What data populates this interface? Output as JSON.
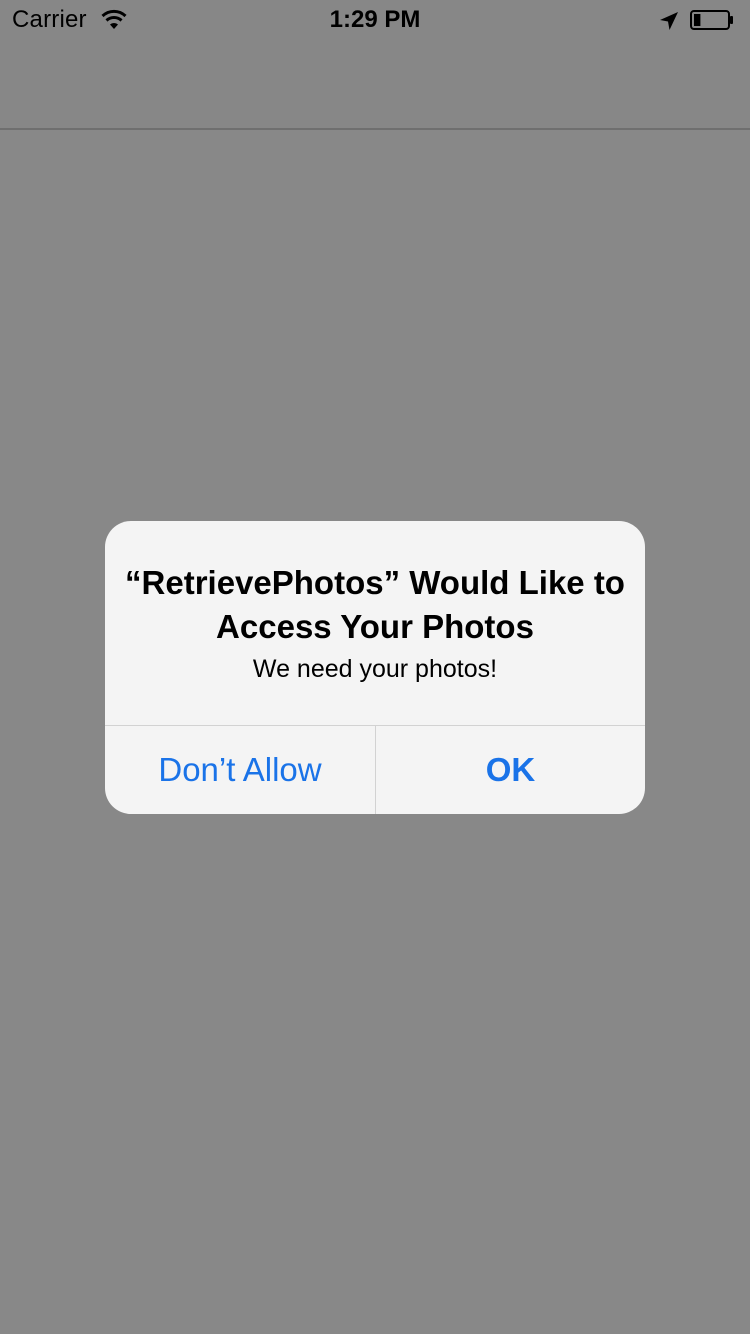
{
  "status_bar": {
    "carrier": "Carrier",
    "time": "1:29 PM",
    "icons": [
      "wifi-icon",
      "location-icon",
      "battery-icon"
    ],
    "battery_level": 0.2
  },
  "alert": {
    "title": "“RetrievePhotos” Would Like to Access Your Photos",
    "message": "We need your photos!",
    "buttons": {
      "deny": "Don’t Allow",
      "allow": "OK"
    },
    "button_color": "#1a73e8",
    "background_color": "#f4f4f4"
  },
  "colors": {
    "dim_background": "#888888"
  }
}
